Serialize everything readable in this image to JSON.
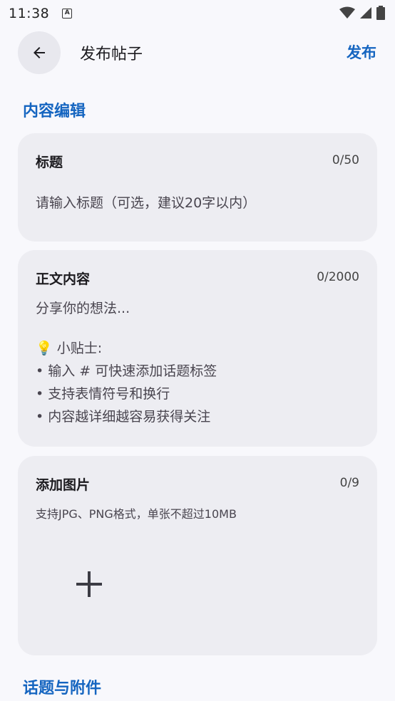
{
  "status_bar": {
    "time": "11:38",
    "notif_icon": "A"
  },
  "app_bar": {
    "title": "发布帖子",
    "action_label": "发布"
  },
  "section_content": {
    "title": "内容编辑"
  },
  "title_card": {
    "label": "标题",
    "count": "0/50",
    "placeholder": "请输入标题（可选，建议20字以内）"
  },
  "body_card": {
    "label": "正文内容",
    "count": "0/2000",
    "placeholder": "分享你的想法...",
    "tips_title": "💡 小贴士:",
    "tips": [
      "• 输入 # 可快速添加话题标签",
      "• 支持表情符号和换行",
      "• 内容越详细越容易获得关注"
    ]
  },
  "image_card": {
    "label": "添加图片",
    "count": "0/9",
    "hint": "支持JPG、PNG格式，单张不超过10MB"
  },
  "section_attachments": {
    "title": "话题与附件"
  },
  "colors": {
    "accent": "#1565c0",
    "card_bg": "#ededf2",
    "page_bg": "#f8f8fc"
  }
}
